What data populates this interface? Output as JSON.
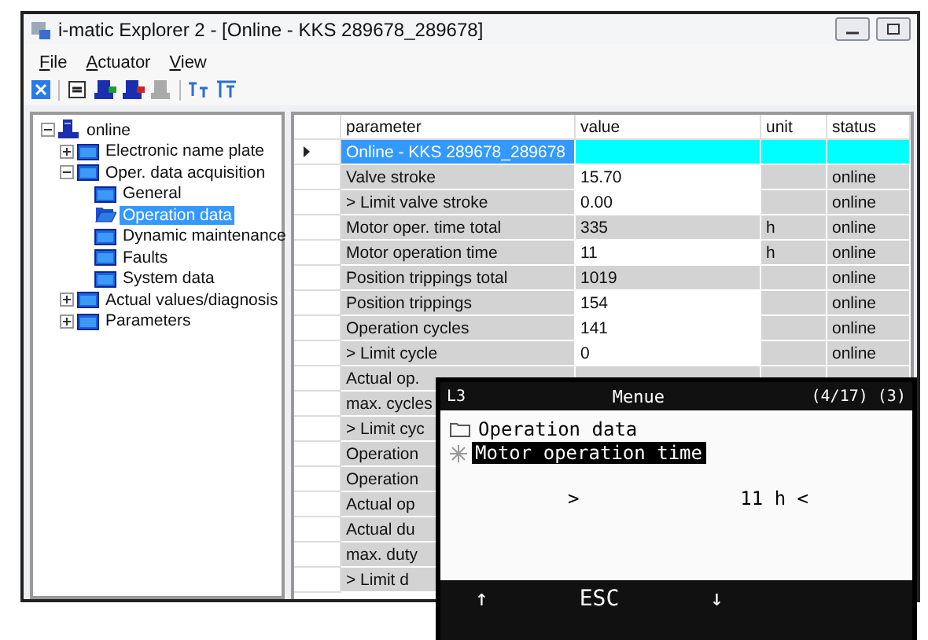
{
  "window": {
    "title": "i-matic Explorer 2 - [Online - KKS 289678_289678]"
  },
  "menu": [
    "File",
    "Actuator",
    "View"
  ],
  "tree": [
    {
      "label": "online",
      "kind": "device",
      "expanded": true,
      "selected": false,
      "children": [
        {
          "label": "Electronic name plate",
          "kind": "folder",
          "expanded": false,
          "selected": false
        },
        {
          "label": "Oper. data acquisition",
          "kind": "folder",
          "expanded": true,
          "selected": false,
          "children": [
            {
              "label": "General",
              "kind": "folder",
              "selected": false
            },
            {
              "label": "Operation data",
              "kind": "open-folder",
              "selected": true
            },
            {
              "label": "Dynamic maintenance",
              "kind": "folder",
              "selected": false
            },
            {
              "label": "Faults",
              "kind": "folder",
              "selected": false
            },
            {
              "label": "System data",
              "kind": "folder",
              "selected": false
            }
          ]
        },
        {
          "label": "Actual values/diagnosis",
          "kind": "folder",
          "expanded": false,
          "selected": false
        },
        {
          "label": "Parameters",
          "kind": "folder",
          "expanded": false,
          "selected": false
        }
      ]
    }
  ],
  "table": {
    "columns": [
      "parameter",
      "value",
      "unit",
      "status"
    ],
    "rows": [
      {
        "parameter": "Online - KKS 289678_289678",
        "selected": true
      },
      {
        "parameter": "Valve stroke",
        "value": "15.70",
        "status": "online",
        "editable": true,
        "selected": false
      },
      {
        "parameter": "> Limit valve stroke",
        "value": "0.00",
        "status": "online",
        "editable": true,
        "selected": false
      },
      {
        "parameter": "Motor oper. time total",
        "value": "335",
        "unit": "h",
        "status": "online",
        "editable": false,
        "selected": false
      },
      {
        "parameter": "Motor operation time",
        "value": "11",
        "unit": "h",
        "status": "online",
        "editable": true,
        "selected": false
      },
      {
        "parameter": "Position trippings total",
        "value": "1019",
        "status": "online",
        "editable": false,
        "selected": false
      },
      {
        "parameter": "Position trippings",
        "value": "154",
        "status": "online",
        "editable": true,
        "selected": false
      },
      {
        "parameter": "Operation cycles",
        "value": "141",
        "status": "online",
        "editable": true,
        "selected": false
      },
      {
        "parameter": "> Limit cycle",
        "value": "0",
        "status": "online",
        "editable": true,
        "selected": false
      },
      {
        "parameter": "Actual op.",
        "selected": false
      },
      {
        "parameter": "max. cycles",
        "selected": false
      },
      {
        "parameter": "> Limit cyc",
        "selected": false
      },
      {
        "parameter": "Operation",
        "selected": false
      },
      {
        "parameter": "Operation",
        "selected": false
      },
      {
        "parameter": "Actual op",
        "selected": false
      },
      {
        "parameter": "Actual du",
        "selected": false
      },
      {
        "parameter": "max. duty",
        "selected": false
      },
      {
        "parameter": "> Limit d",
        "selected": false
      }
    ]
  },
  "display": {
    "line": "L3",
    "title": "Menue",
    "position": "(4/17) (3)",
    "items": [
      {
        "label": "Operation data",
        "kind": "folder",
        "selected": false
      },
      {
        "label": "Motor operation time",
        "kind": "star",
        "selected": true
      }
    ],
    "reading_prefix": ">",
    "reading": "11 h <",
    "keys": [
      "↑",
      "ESC",
      "↓"
    ]
  }
}
